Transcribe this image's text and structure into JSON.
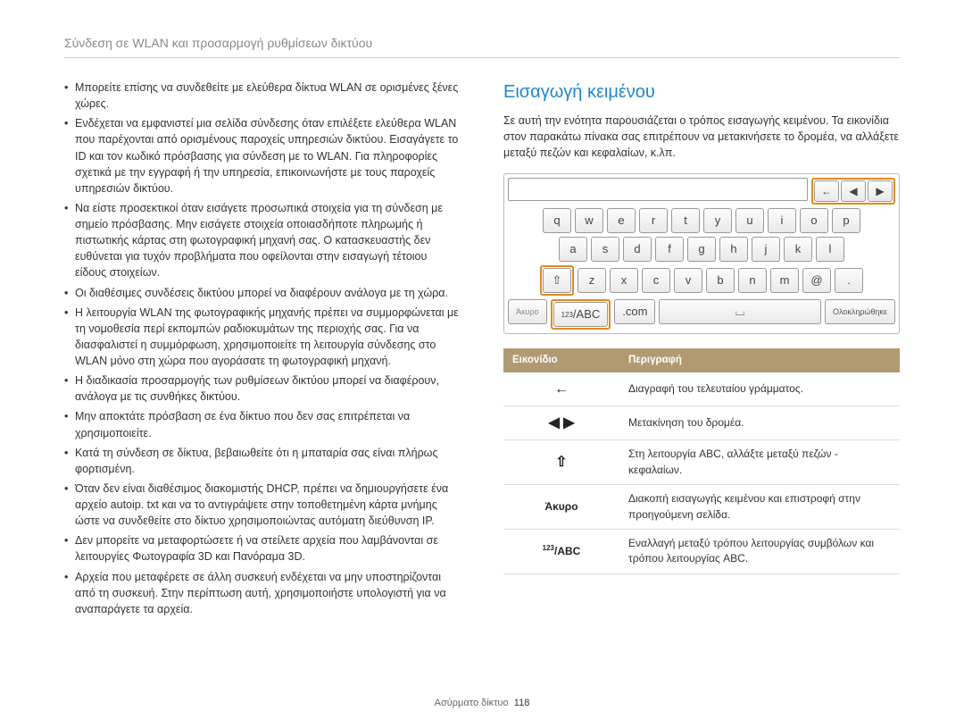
{
  "header": "Σύνδεση σε WLAN και προσαρμογή ρυθμίσεων δικτύου",
  "left_bullets": [
    "Μπορείτε επίσης να συνδεθείτε με ελεύθερα δίκτυα WLAN σε ορισμένες ξένες χώρες.",
    "Ενδέχεται να εμφανιστεί μια σελίδα σύνδεσης όταν επιλέξετε ελεύθερα WLAN που παρέχονται από ορισμένους παροχείς υπηρεσιών δικτύου. Εισαγάγετε το ID και τον κωδικό πρόσβασης για σύνδεση με το WLAN. Για πληροφορίες σχετικά με την εγγραφή ή την υπηρεσία, επικοινωνήστε με τους παροχείς υπηρεσιών δικτύου.",
    "Να είστε προσεκτικοί όταν εισάγετε προσωπικά στοιχεία για τη σύνδεση με σημείο πρόσβασης. Μην εισάγετε στοιχεία οποιασδήποτε πληρωμής ή πιστωτικής κάρτας στη φωτογραφική μηχανή σας. Ο κατασκευαστής δεν ευθύνεται για τυχόν προβλήματα που οφείλονται στην εισαγωγή τέτοιου είδους στοιχείων.",
    "Οι διαθέσιμες συνδέσεις δικτύου μπορεί να διαφέρουν ανάλογα με τη χώρα.",
    "Η λειτουργία WLAN της φωτογραφικής μηχανής πρέπει να συμμορφώνεται με τη νομοθεσία περί εκπομπών ραδιοκυμάτων της περιοχής σας. Για να διασφαλιστεί η συμμόρφωση, χρησιμοποιείτε τη λειτουργία σύνδεσης στο WLAN μόνο στη χώρα που αγοράσατε τη φωτογραφική μηχανή.",
    "Η διαδικασία προσαρμογής των ρυθμίσεων δικτύου μπορεί να διαφέρουν, ανάλογα με τις συνθήκες δικτύου.",
    "Μην αποκτάτε πρόσβαση σε ένα δίκτυο που δεν σας επιτρέπεται να χρησιμοποιείτε.",
    "Κατά τη σύνδεση σε δίκτυα, βεβαιωθείτε ότι η μπαταρία σας είναι πλήρως φορτισμένη.",
    "Όταν δεν είναι διαθέσιμος διακομιστής DHCP, πρέπει να δημιουργήσετε ένα αρχείο autoip. txt και να το αντιγράψετε στην τοποθετημένη κάρτα μνήμης ώστε να συνδεθείτε στο δίκτυο χρησιμοποιώντας αυτόματη διεύθυνση IP.",
    "Δεν μπορείτε να μεταφορτώσετε ή να στείλετε αρχεία που λαμβάνονται σε λειτουργίες Φωτογραφία 3D και Πανόραμα 3D.",
    "Αρχεία που μεταφέρετε σε άλλη συσκευή ενδέχεται να μην υποστηρίζονται από τη συσκευή. Στην περίπτωση αυτή, χρησιμοποιήστε υπολογιστή για να αναπαράγετε τα αρχεία."
  ],
  "right": {
    "heading": "Εισαγωγή κειμένου",
    "intro": "Σε αυτή την ενότητα παρουσιάζεται ο τρόπος εισαγωγής κειμένου. Τα εικονίδια στον παρακάτω πίνακα σας επιτρέπουν να μετακινήσετε το δρομέα, να αλλάξετε μεταξύ πεζών και κεφαλαίων, κ.λπ.",
    "keyboard": {
      "nav": {
        "back": "←",
        "left": "◀",
        "right": "▶"
      },
      "row1": [
        "q",
        "w",
        "e",
        "r",
        "t",
        "y",
        "u",
        "i",
        "o",
        "p"
      ],
      "row2": [
        "a",
        "s",
        "d",
        "f",
        "g",
        "h",
        "j",
        "k",
        "l"
      ],
      "shift": "⇧",
      "row3": [
        "z",
        "x",
        "c",
        "v",
        "b",
        "n",
        "m",
        "@",
        "."
      ],
      "bottom": {
        "cancel": "Άκυρο",
        "mode_prefix": "123",
        "mode_suffix": "/ABC",
        "com": ".com",
        "space": "⌴",
        "done": "Ολοκληρώθηκε"
      }
    },
    "table": {
      "headers": {
        "icon": "Εικονίδιο",
        "desc": "Περιγραφή"
      },
      "rows": [
        {
          "icon": "←",
          "kind": "glyph",
          "desc": "Διαγραφή του τελευταίου γράμματος."
        },
        {
          "icon": "◀ ▶",
          "kind": "glyph",
          "desc": "Μετακίνηση του δρομέα."
        },
        {
          "icon": "⇧",
          "kind": "glyph",
          "desc": "Στη λειτουργία ABC, αλλάξτε μεταξύ πεζών - κεφαλαίων."
        },
        {
          "icon": "Άκυρο",
          "kind": "text",
          "desc": "Διακοπή εισαγωγής κειμένου και επιστροφή στην προηγούμενη σελίδα."
        },
        {
          "icon": "123 /ABC",
          "kind": "mode",
          "desc": "Εναλλαγή μεταξύ τρόπου λειτουργίας συμβόλων και τρόπου λειτουργίας ABC."
        }
      ]
    }
  },
  "footer": {
    "section": "Ασύρματο δίκτυο",
    "page": "118"
  }
}
